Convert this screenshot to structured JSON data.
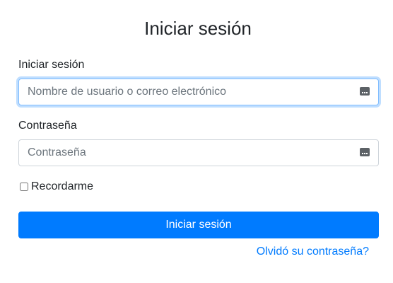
{
  "page": {
    "title": "Iniciar sesión"
  },
  "form": {
    "username_label": "Iniciar sesión",
    "username_placeholder": "Nombre de usuario o correo electrónico",
    "username_value": "",
    "password_label": "Contraseña",
    "password_placeholder": "Contraseña",
    "password_value": "",
    "remember_label": "Recordarme",
    "remember_checked": false,
    "submit_label": "Iniciar sesión",
    "forgot_label": "Olvidó su contraseña?",
    "field_icon": "password-manager-key-icon"
  },
  "colors": {
    "accent": "#007bff",
    "focus_border": "#80bdff",
    "text": "#212529",
    "placeholder": "#6c757d"
  }
}
